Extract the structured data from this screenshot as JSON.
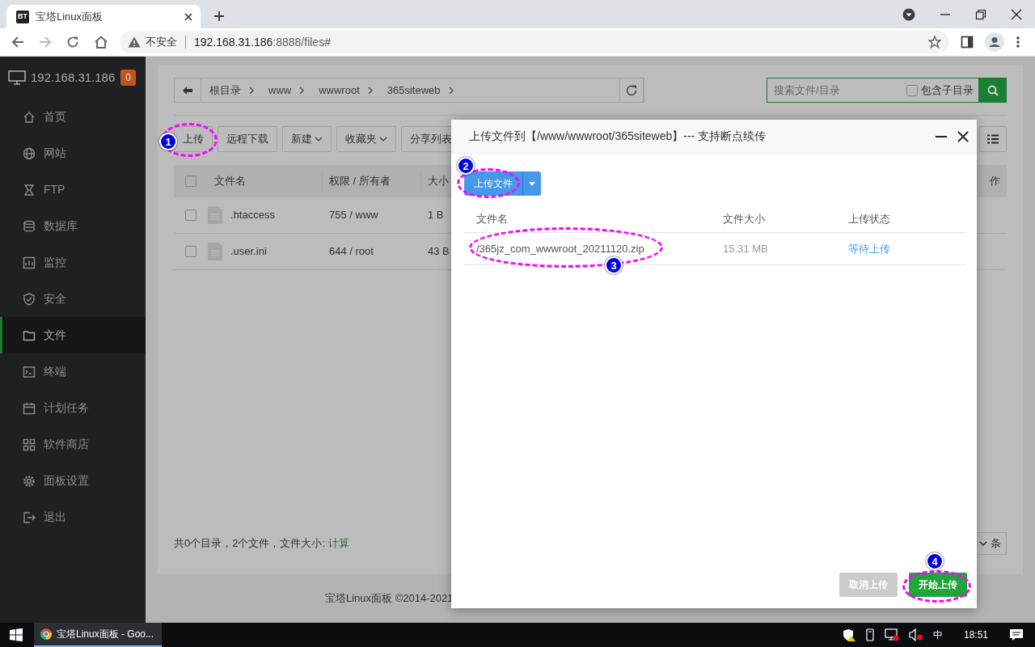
{
  "browser": {
    "tab_favicon": "BT",
    "tab_title": "宝塔Linux面板",
    "security_label": "不安全",
    "url_host": "192.168.31.186",
    "url_rest": ":8888/files#"
  },
  "sidebar": {
    "host": "192.168.31.186",
    "badge": "0",
    "items": [
      {
        "label": "首页",
        "kind": "home",
        "selected": false
      },
      {
        "label": "网站",
        "kind": "globe",
        "selected": false
      },
      {
        "label": "FTP",
        "kind": "ftp",
        "selected": false
      },
      {
        "label": "数据库",
        "kind": "database",
        "selected": false
      },
      {
        "label": "监控",
        "kind": "monitor",
        "selected": false
      },
      {
        "label": "安全",
        "kind": "shield",
        "selected": false
      },
      {
        "label": "文件",
        "kind": "folder",
        "selected": true
      },
      {
        "label": "终端",
        "kind": "terminal",
        "selected": false
      },
      {
        "label": "计划任务",
        "kind": "calendar",
        "selected": false
      },
      {
        "label": "软件商店",
        "kind": "grid",
        "selected": false
      },
      {
        "label": "面板设置",
        "kind": "gear",
        "selected": false
      },
      {
        "label": "退出",
        "kind": "exit",
        "selected": false
      }
    ]
  },
  "breadcrumb": [
    "根目录",
    "www",
    "wwwroot",
    "365siteweb"
  ],
  "search": {
    "placeholder": "搜索文件/目录",
    "subdir_label": "包含子目录",
    "subdir_checked": false
  },
  "toolbar": [
    {
      "label": "上传",
      "dropdown": false
    },
    {
      "label": "远程下载",
      "dropdown": false
    },
    {
      "label": "新建",
      "dropdown": true
    },
    {
      "label": "收藏夹",
      "dropdown": true
    },
    {
      "label": "分享列表",
      "dropdown": false
    }
  ],
  "file_table": {
    "all_checked": false,
    "columns": [
      "文件名",
      "权限 / 所有者",
      "大小"
    ],
    "column_last": "作",
    "rows": [
      {
        "checked": false,
        "name": ".htaccess",
        "permission": "755 / www",
        "size": "1 B"
      },
      {
        "checked": false,
        "name": ".user.ini",
        "permission": "644 / root",
        "size": "43 B"
      }
    ]
  },
  "summary": {
    "text": "共0个目录，2个文件，文件大小: ",
    "link": "计算"
  },
  "pager": {
    "label": "条"
  },
  "footer": "宝塔Linux面板 ©2014-2021",
  "dialog": {
    "title": "上传文件到【/www/wwwroot/365siteweb】--- 支持断点续传",
    "upload_button": "上传文件",
    "columns": [
      "文件名",
      "文件大小",
      "上传状态"
    ],
    "files": [
      {
        "name": "/365jz_com_wwwroot_20211120.zip",
        "size": "15.31 MB",
        "status": "等待上传"
      }
    ],
    "cancel_button": "取消上传",
    "start_button": "开始上传"
  },
  "annotations": [
    {
      "number": "1"
    },
    {
      "number": "2"
    },
    {
      "number": "3"
    },
    {
      "number": "4"
    }
  ],
  "taskbar": {
    "app_title": "宝塔Linux面板 - Goo...",
    "ime": "中",
    "time": "18:51"
  }
}
